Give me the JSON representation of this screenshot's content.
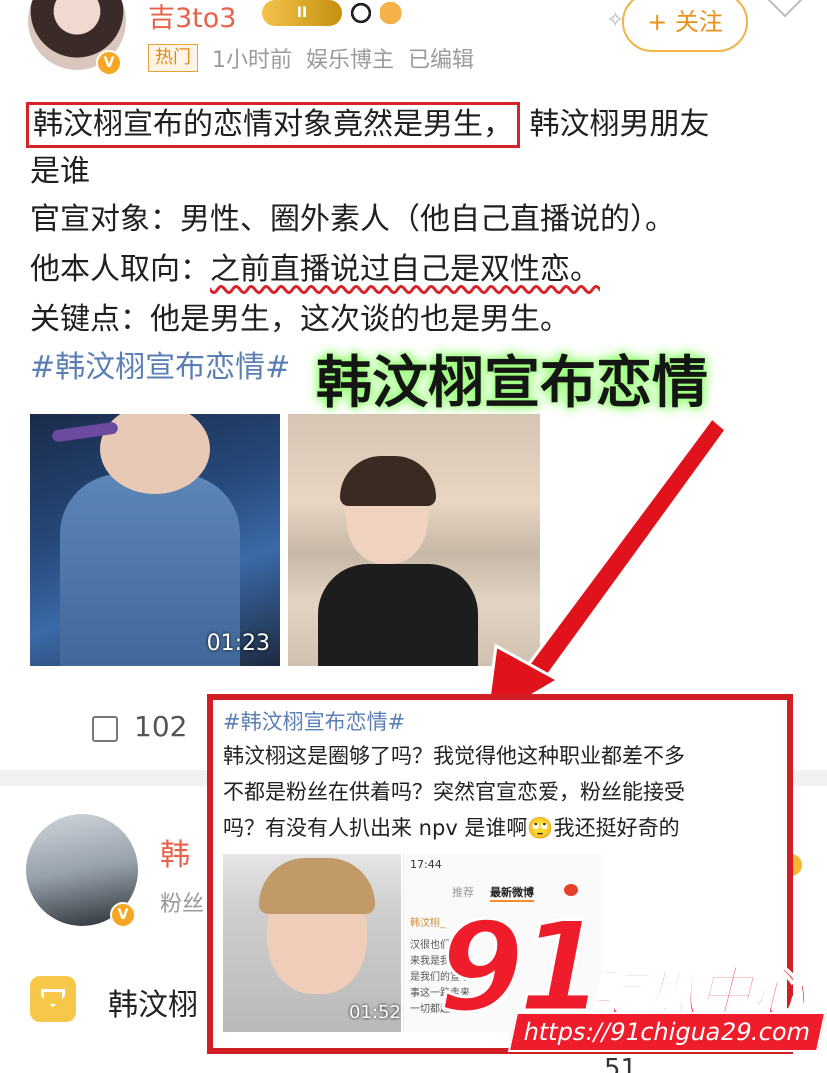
{
  "post": {
    "username": "吉3to3",
    "vip_level": "II",
    "hot_tag": "热门",
    "time": "1小时前",
    "role": "娱乐博主",
    "edited": "已编辑",
    "follow_label": "+ 关注",
    "headline": "韩汶栩宣布的恋情对象竟然是男生，",
    "headline_rest": "韩汶栩男朋友",
    "line2": "是谁",
    "line3": "官宣对象：男性、圈外素人（他自己直播说的）。",
    "line4_prefix": "他本人取向：",
    "line4_highlight": "之前直播说过自己是双性恋。",
    "line5": "关键点：他是男生，这次谈的也是男生。",
    "hashtag": "#韩汶栩宣布恋情#",
    "big_title": "韩汶栩宣布恋情",
    "video_duration": "01:23",
    "share_count": "102"
  },
  "second_post": {
    "name": "韩",
    "fans": "粉丝",
    "text": "韩汶栩",
    "bottom_text": "51"
  },
  "inset": {
    "hashtag": "#韩汶栩宣布恋情#",
    "lines": [
      "韩汶栩这是圈够了吗？我觉得他这种职业都差不多",
      "不都是粉丝在供着吗？突然官宣恋爱，粉丝能接受",
      "吗？有没有人扒出来 npv 是谁啊🙄我还挺好奇的"
    ],
    "video_duration": "01:52",
    "phone": {
      "status": "17:44",
      "tab_recommend": "推荐",
      "tab_latest": "最新微博",
      "user": "韩汶栩_",
      "text_lines": [
        "汉很也们 我",
        "来我是我们 来",
        "是我们的宣 关",
        "事这一路走来",
        "一切都越来越好"
      ]
    }
  },
  "watermark": {
    "number": "91",
    "name": "吃瓜中心",
    "url": "https://91chigua29.com"
  },
  "colors": {
    "accent_red": "#d6242a",
    "username": "#e8624a",
    "link_blue": "#5b7fb5",
    "follow_orange": "#e7921d"
  }
}
